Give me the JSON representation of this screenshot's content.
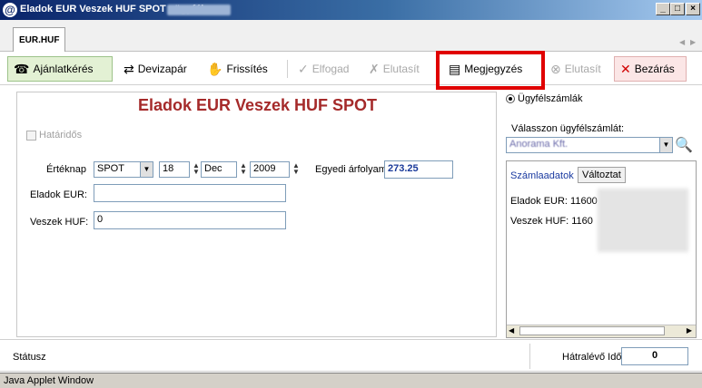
{
  "window": {
    "title": "Eladok EUR Veszek HUF SPOT , ügyfél",
    "controls": {
      "minimize": "_",
      "maximize": "□",
      "close": "×"
    }
  },
  "tabs": [
    {
      "label": "EUR.HUF"
    }
  ],
  "toolbar": {
    "quote_request": "Ajánlatkérés",
    "currency_pair": "Devizapár",
    "refresh": "Frissítés",
    "accept": "Elfogad",
    "reject": "Elutasít",
    "note": "Megjegyzés",
    "reject2": "Elutasít",
    "close": "Bezárás"
  },
  "deal": {
    "title": "Eladok EUR Veszek HUF SPOT",
    "forward_label": "Határidős",
    "value_date_label": "Értéknap",
    "value_date_type": "SPOT",
    "day": "18",
    "month": "Dec",
    "year": "2009",
    "custom_rate_label": "Egyedi árfolyam",
    "custom_rate": "273.25",
    "sell_label": "Eladok EUR:",
    "sell_value": "",
    "buy_label": "Veszek HUF:",
    "buy_value": "0"
  },
  "accounts": {
    "radio_label": "Ügyfélszámlák",
    "choose_label": "Válasszon ügyfélszámlát:",
    "selected_account": "Anorama Kft.",
    "details_label": "Számlaadatok",
    "change_button": "Változtat",
    "sell_account": "Eladok EUR: 11600",
    "buy_account": "Veszek HUF: 1160"
  },
  "status": {
    "label": "Státusz",
    "remaining_label": "Hátralévő Idő",
    "remaining_value": "0"
  },
  "java_bar": "Java Applet Window"
}
